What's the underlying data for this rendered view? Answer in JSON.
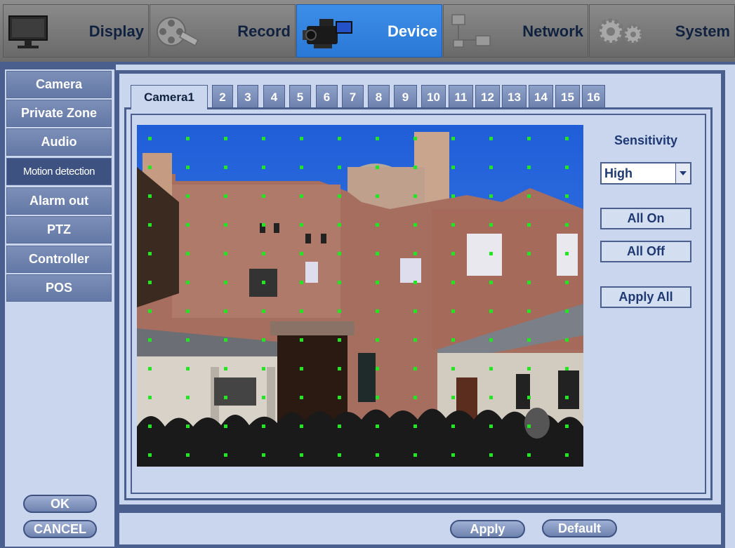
{
  "top_tabs": [
    {
      "label": "Display",
      "icon": "monitor-icon"
    },
    {
      "label": "Record",
      "icon": "film-reel-icon"
    },
    {
      "label": "Device",
      "icon": "camcorder-icon",
      "active": true
    },
    {
      "label": "Network",
      "icon": "network-icon"
    },
    {
      "label": "System",
      "icon": "gears-icon"
    }
  ],
  "sidebar": {
    "items": [
      {
        "label": "Camera"
      },
      {
        "label": "Private Zone"
      },
      {
        "label": "Audio"
      },
      {
        "label": "Motion detection",
        "active": true
      },
      {
        "label": "Alarm out"
      },
      {
        "label": "PTZ"
      },
      {
        "label": "Controller"
      },
      {
        "label": "POS"
      }
    ],
    "ok_label": "OK",
    "cancel_label": "CANCEL"
  },
  "camera_tabs": [
    "Camera1",
    "2",
    "3",
    "4",
    "5",
    "6",
    "7",
    "8",
    "9",
    "10",
    "11",
    "12",
    "13",
    "14",
    "15",
    "16"
  ],
  "motion": {
    "sensitivity_label": "Sensitivity",
    "sensitivity_value": "High",
    "all_on_label": "All On",
    "all_off_label": "All Off",
    "apply_all_label": "Apply All"
  },
  "footer": {
    "apply_label": "Apply",
    "default_label": "Default"
  },
  "colors": {
    "frame": "#4b5f8e",
    "panel": "#c9d6ee",
    "active_tab": "#2a78d6",
    "grid_dot": "#22e622"
  }
}
